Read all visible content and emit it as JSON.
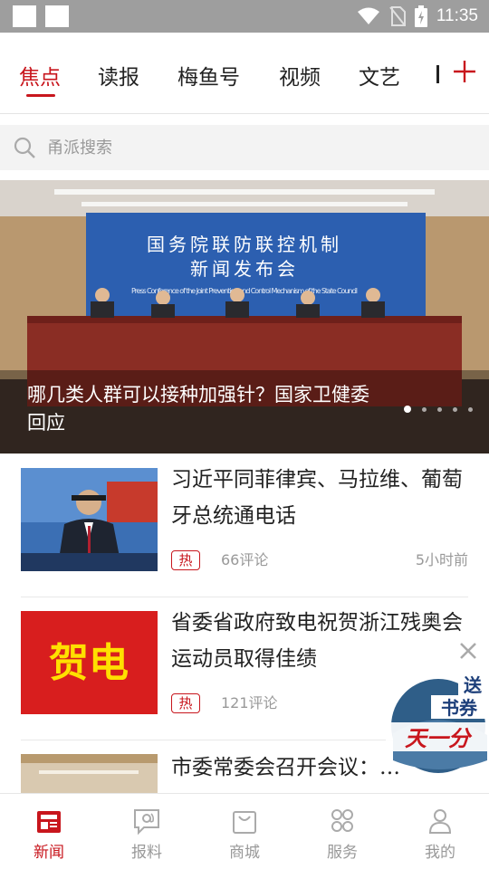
{
  "status_bar": {
    "time": "11:35"
  },
  "tabs": [
    {
      "label": "焦点",
      "active": true
    },
    {
      "label": "读报"
    },
    {
      "label": "梅鱼号"
    },
    {
      "label": "视频"
    },
    {
      "label": "文艺"
    }
  ],
  "search": {
    "placeholder": "甬派搜索"
  },
  "banner": {
    "title": "哪几类人群可以接种加强针？国家卫健委回应",
    "sign_line1": "国务院联防联控机制",
    "sign_line2": "新闻发布会",
    "sign_en": "Press Conference of the Joint Prevention and Control Mechanism of the State Council",
    "slide_count": 5,
    "active_slide": 1
  },
  "news": [
    {
      "title": "习近平同菲律宾、马拉维、葡萄牙总统通电话",
      "badge": "热",
      "comments": "66评论",
      "time": "5小时前"
    },
    {
      "title": "省委省政府致电祝贺浙江残奥会运动员取得佳绩",
      "badge": "热",
      "comments": "121评论",
      "time": "",
      "thumb_text": "贺电"
    },
    {
      "title": "市委常委会召开会议：…",
      "badge": "",
      "comments": "",
      "time": ""
    }
  ],
  "float_ad": {
    "line1": "送",
    "line2": "书券",
    "line3": "天一分"
  },
  "bottom_nav": [
    {
      "label": "新闻",
      "icon": "newspaper-icon",
      "active": true
    },
    {
      "label": "报料",
      "icon": "report-at-icon"
    },
    {
      "label": "商城",
      "icon": "shopping-bag-icon"
    },
    {
      "label": "服务",
      "icon": "services-grid-icon"
    },
    {
      "label": "我的",
      "icon": "user-profile-icon"
    }
  ],
  "colors": {
    "accent": "#c8161d",
    "muted": "#999999"
  }
}
